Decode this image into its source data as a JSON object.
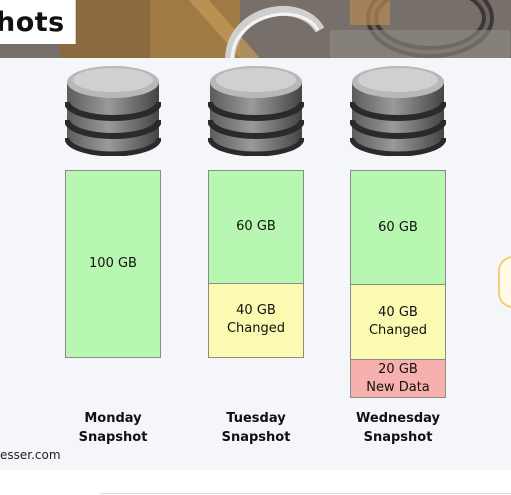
{
  "header": {
    "title": "hots"
  },
  "columns": [
    {
      "label": "Monday\nSnapshot",
      "segments": [
        {
          "text": "100 GB",
          "kind": "green",
          "share": 1.0
        }
      ]
    },
    {
      "label": "Tuesday\nSnapshot",
      "segments": [
        {
          "text": "60 GB",
          "kind": "green",
          "share": 0.6
        },
        {
          "text": "40 GB\nChanged",
          "kind": "yellow",
          "share": 0.4
        }
      ]
    },
    {
      "label": "Wednesday\nSnapshot",
      "segments": [
        {
          "text": "60 GB",
          "kind": "green",
          "share": 0.6
        },
        {
          "text": "40 GB\nChanged",
          "kind": "yellow",
          "share": 0.4
        },
        {
          "text": "20 GB\nNew Data",
          "kind": "red",
          "share": 0.2
        }
      ]
    }
  ],
  "footer": {
    "source": "esser.com"
  },
  "colors": {
    "green": "#b7f7b1",
    "yellow": "#fafab0",
    "red": "#f6b0ae"
  }
}
